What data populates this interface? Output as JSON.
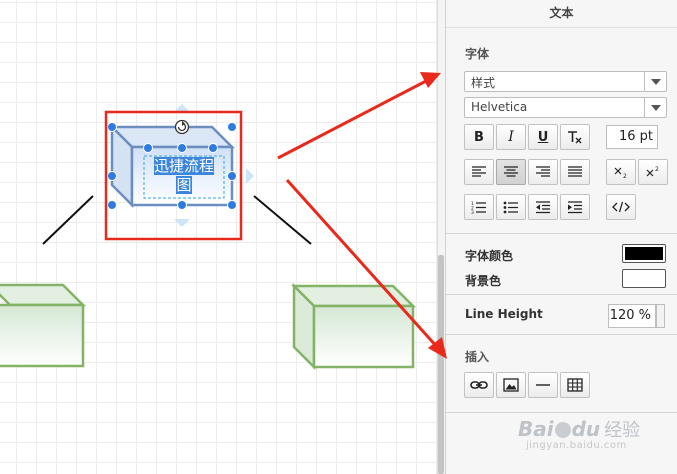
{
  "canvas": {
    "selected_shape_text_line1": "迅捷流程",
    "selected_shape_text_line2": "图"
  },
  "panel": {
    "tab_title": "文本",
    "font": {
      "section_title": "字体",
      "style_select_value": "样式",
      "family_select_value": "Helvetica",
      "bold_label": "B",
      "italic_label": "I",
      "underline_label": "U",
      "font_size_value": "16 pt"
    },
    "colors": {
      "font_color_label": "字体颜色",
      "font_color": "#000000",
      "background_color_label": "背景色",
      "background_color": "#ffffff"
    },
    "line_height": {
      "label": "Line Height",
      "value": "120 %"
    },
    "insert": {
      "section_title": "插入"
    }
  },
  "watermark": {
    "logo": "Bai",
    "logo_suffix": "du",
    "jingyan": "经验",
    "url": "jingyan.baidu.com"
  },
  "colors": {
    "accent_blue": "#2f7ce0",
    "shape_green_stroke": "#82b366",
    "shape_green_fill": "#d5e8d4",
    "annotation_red": "#e8291c"
  }
}
